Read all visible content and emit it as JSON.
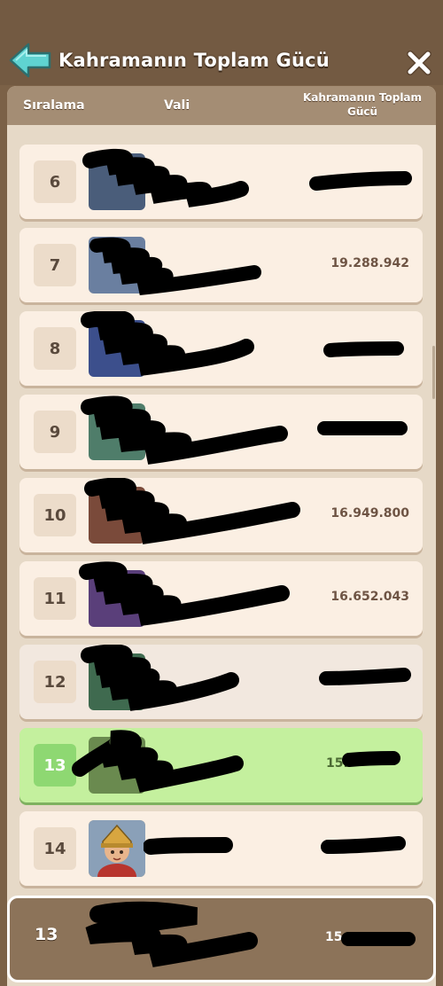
{
  "header": {
    "title": "Kahramanın Toplam Gücü",
    "back_icon": "arrow-left-icon",
    "close_icon": "close-icon"
  },
  "columns": {
    "rank": "Sıralama",
    "governor": "Vali",
    "power": "Kahramanın Toplam Gücü"
  },
  "rows": [
    {
      "rank": "6",
      "power": ""
    },
    {
      "rank": "7",
      "power": "19.288.942"
    },
    {
      "rank": "8",
      "power": ""
    },
    {
      "rank": "9",
      "power": ""
    },
    {
      "rank": "10",
      "power": "16.949.800"
    },
    {
      "rank": "11",
      "power": "16.652.043"
    },
    {
      "rank": "12",
      "power": ""
    },
    {
      "rank": "13",
      "power": "15."
    },
    {
      "rank": "14",
      "power": ""
    }
  ],
  "footer": {
    "rank": "13",
    "power": "15"
  },
  "colors": {
    "background": "#7b6147",
    "row": "#fbefe3",
    "highlight_row": "#c4f09e",
    "accent_arrow": "#5fd3d1"
  }
}
